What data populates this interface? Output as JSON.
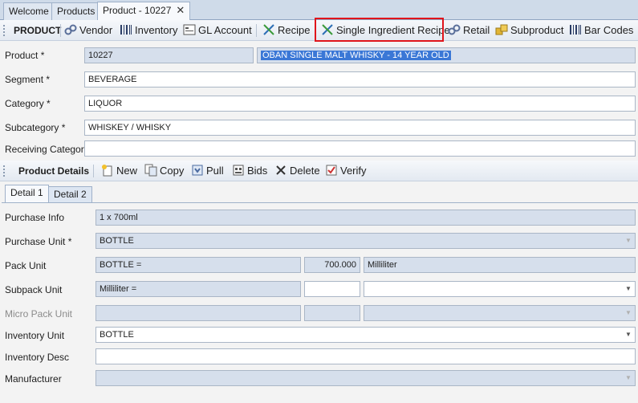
{
  "tabs": [
    {
      "label": "Welcome"
    },
    {
      "label": "Products"
    },
    {
      "label": "Product - 10227",
      "close": "✕"
    }
  ],
  "product_toolbar": {
    "title": "PRODUCT",
    "items": [
      {
        "label": "Vendor",
        "icon": "vendor-icon"
      },
      {
        "label": "Inventory",
        "icon": "barcode-icon"
      },
      {
        "label": "GL Account",
        "icon": "gl-account-icon"
      },
      {
        "label": "Recipe",
        "icon": "fork-knife-icon"
      },
      {
        "label": "Single Ingredient Recipe",
        "icon": "fork-knife-icon"
      },
      {
        "label": "Retail",
        "icon": "vendor-icon"
      },
      {
        "label": "Subproduct",
        "icon": "boxes-icon"
      },
      {
        "label": "Bar Codes",
        "icon": "barcode-icon"
      }
    ],
    "highlight_color": "#e0151b"
  },
  "header_form": {
    "product": {
      "label": "Product *",
      "code": "10227",
      "name": "OBAN SINGLE MALT WHISKY - 14 YEAR OLD"
    },
    "segment": {
      "label": "Segment *",
      "value": "BEVERAGE"
    },
    "category": {
      "label": "Category *",
      "value": "LIQUOR"
    },
    "subcategory": {
      "label": "Subcategory *",
      "value": "WHISKEY / WHISKY"
    },
    "receiving_category": {
      "label": "Receiving Category",
      "value": ""
    }
  },
  "details_toolbar": {
    "title": "Product Details",
    "items": [
      {
        "label": "New",
        "icon": "new-icon"
      },
      {
        "label": "Copy",
        "icon": "copy-icon"
      },
      {
        "label": "Pull",
        "icon": "pull-icon"
      },
      {
        "label": "Bids",
        "icon": "bids-icon"
      },
      {
        "label": "Delete",
        "icon": "delete-icon"
      },
      {
        "label": "Verify",
        "icon": "verify-icon"
      }
    ]
  },
  "detail_tabs": [
    {
      "label": "Detail 1"
    },
    {
      "label": "Detail 2"
    }
  ],
  "detail_form": {
    "purchase_info": {
      "label": "Purchase Info",
      "value": "1 x 700ml"
    },
    "purchase_unit": {
      "label": "Purchase Unit *",
      "value": "BOTTLE"
    },
    "pack_unit": {
      "label": "Pack Unit",
      "value": "BOTTLE =",
      "qty": "700.000",
      "unit": "Milliliter"
    },
    "subpack_unit": {
      "label": "Subpack Unit",
      "value": "Milliliter =",
      "qty": "",
      "unit": ""
    },
    "micro_pack_unit": {
      "label": "Micro Pack Unit",
      "value": "",
      "qty": "",
      "unit": ""
    },
    "inventory_unit": {
      "label": "Inventory Unit",
      "value": "BOTTLE"
    },
    "inventory_desc": {
      "label": "Inventory Desc",
      "value": ""
    },
    "manufacturer": {
      "label": "Manufacturer",
      "value": ""
    }
  }
}
